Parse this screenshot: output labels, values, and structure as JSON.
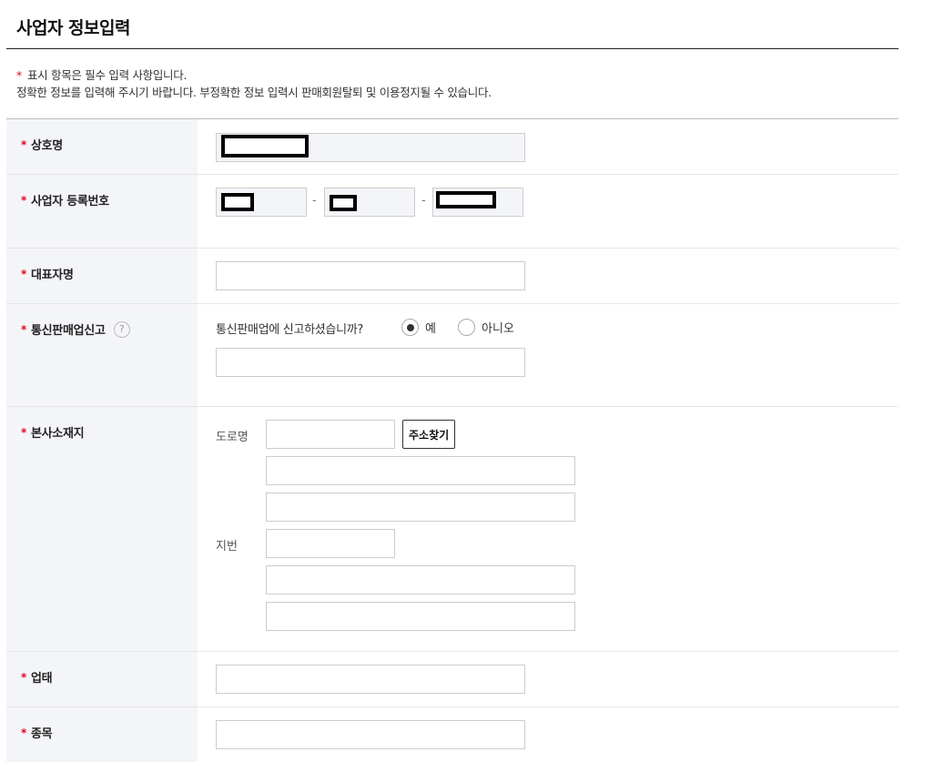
{
  "page": {
    "title": "사업자 정보입력",
    "notice_star": "*",
    "notice_line1": "표시 항목은 필수 입력 사항입니다.",
    "notice_line2": "정확한 정보를 입력해 주시기 바랍니다. 부정확한 정보 입력시 판매회원탈퇴 및 이용정지될 수 있습니다."
  },
  "form": {
    "required_mark": "*",
    "company_name": {
      "label": "상호명",
      "value": ""
    },
    "business_number": {
      "label": "사업자 등록번호",
      "separator": "-",
      "part1": "",
      "part2": "",
      "part3": ""
    },
    "representative": {
      "label": "대표자명",
      "value": ""
    },
    "mail_order": {
      "label": "통신판매업신고",
      "help_icon": "?",
      "question": "통신판매업에 신고하셨습니까?",
      "options": [
        "예",
        "아니오"
      ],
      "selected": "예",
      "value": ""
    },
    "address": {
      "label": "본사소재지",
      "road_label": "도로명",
      "lot_label": "지번",
      "search_button": "주소찾기"
    },
    "business_type": {
      "label": "업태",
      "value": ""
    },
    "business_item": {
      "label": "종목",
      "value": ""
    }
  },
  "colors": {
    "required": "#e4001b",
    "label_bg": "#f4f5f9"
  },
  "icons": {
    "help": "question-circle-icon"
  }
}
